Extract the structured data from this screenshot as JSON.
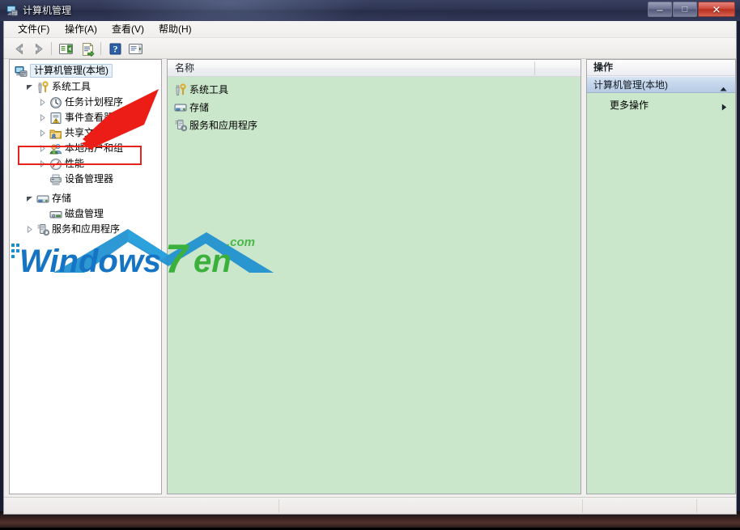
{
  "window": {
    "title": "计算机管理",
    "icon": "computer-management-icon",
    "controls": {
      "minimize_label": "–",
      "maximize_label": "□",
      "close_label": "✕"
    }
  },
  "menubar": {
    "items": [
      {
        "label": "文件(F)",
        "name": "menu-file"
      },
      {
        "label": "操作(A)",
        "name": "menu-action"
      },
      {
        "label": "查看(V)",
        "name": "menu-view"
      },
      {
        "label": "帮助(H)",
        "name": "menu-help"
      }
    ]
  },
  "toolbar": {
    "buttons": [
      {
        "name": "back-button",
        "icon": "arrow-left-icon"
      },
      {
        "name": "forward-button",
        "icon": "arrow-right-icon"
      },
      {
        "name": "show-hide-tree-button",
        "icon": "tree-panel-icon"
      },
      {
        "name": "export-list-button",
        "icon": "export-list-icon"
      },
      {
        "name": "help-button",
        "icon": "question-mark-icon"
      },
      {
        "name": "show-action-pane-button",
        "icon": "action-pane-icon"
      }
    ]
  },
  "tree": {
    "items": [
      {
        "label": "计算机管理(本地)",
        "indent": 0,
        "expander": "none",
        "icon": "computer-management-icon",
        "selected": true
      },
      {
        "label": "系统工具",
        "indent": 1,
        "expander": "expanded",
        "icon": "system-tools-icon",
        "selected": false
      },
      {
        "label": "任务计划程序",
        "indent": 2,
        "expander": "collapsed",
        "icon": "task-scheduler-icon",
        "selected": false
      },
      {
        "label": "事件查看器",
        "indent": 2,
        "expander": "collapsed",
        "icon": "event-viewer-icon",
        "selected": false
      },
      {
        "label": "共享文件夹",
        "indent": 2,
        "expander": "collapsed",
        "icon": "shared-folders-icon",
        "selected": false
      },
      {
        "label": "本地用户和组",
        "indent": 2,
        "expander": "collapsed",
        "icon": "local-users-groups-icon",
        "selected": false
      },
      {
        "label": "性能",
        "indent": 2,
        "expander": "collapsed",
        "icon": "performance-icon",
        "selected": false
      },
      {
        "label": "设备管理器",
        "indent": 2,
        "expander": "none",
        "icon": "device-manager-icon",
        "selected": false
      },
      {
        "label": "存储",
        "indent": 1,
        "expander": "expanded",
        "icon": "storage-icon",
        "selected": false
      },
      {
        "label": "磁盘管理",
        "indent": 2,
        "expander": "none",
        "icon": "disk-management-icon",
        "selected": false
      },
      {
        "label": "服务和应用程序",
        "indent": 1,
        "expander": "collapsed",
        "icon": "services-applications-icon",
        "selected": false
      }
    ]
  },
  "list": {
    "columns": [
      {
        "label": "名称",
        "name": "column-name"
      },
      {
        "label": "",
        "name": "column-blank"
      }
    ],
    "rows": [
      {
        "label": "系统工具",
        "icon": "system-tools-icon"
      },
      {
        "label": "存储",
        "icon": "storage-icon"
      },
      {
        "label": "服务和应用程序",
        "icon": "services-applications-icon"
      }
    ]
  },
  "actions": {
    "header": "操作",
    "group_label": "计算机管理(本地)",
    "more_label": "更多操作"
  },
  "watermark": {
    "text_primary": "Windows",
    "text_seven": "7",
    "text_en": "en",
    "text_com": ".com",
    "color_blue": "#1c8fd0",
    "color_green": "#3fb53f"
  },
  "annotation": {
    "highlight_target": "本地用户和组",
    "box_color": "#e8231a",
    "arrow_color": "#ec1c16"
  },
  "colors": {
    "pane_green": "#cbe7cb",
    "tree_white": "#ffffff",
    "titlebar_blue": "#2e3552",
    "close_red": "#cf4a3c"
  }
}
